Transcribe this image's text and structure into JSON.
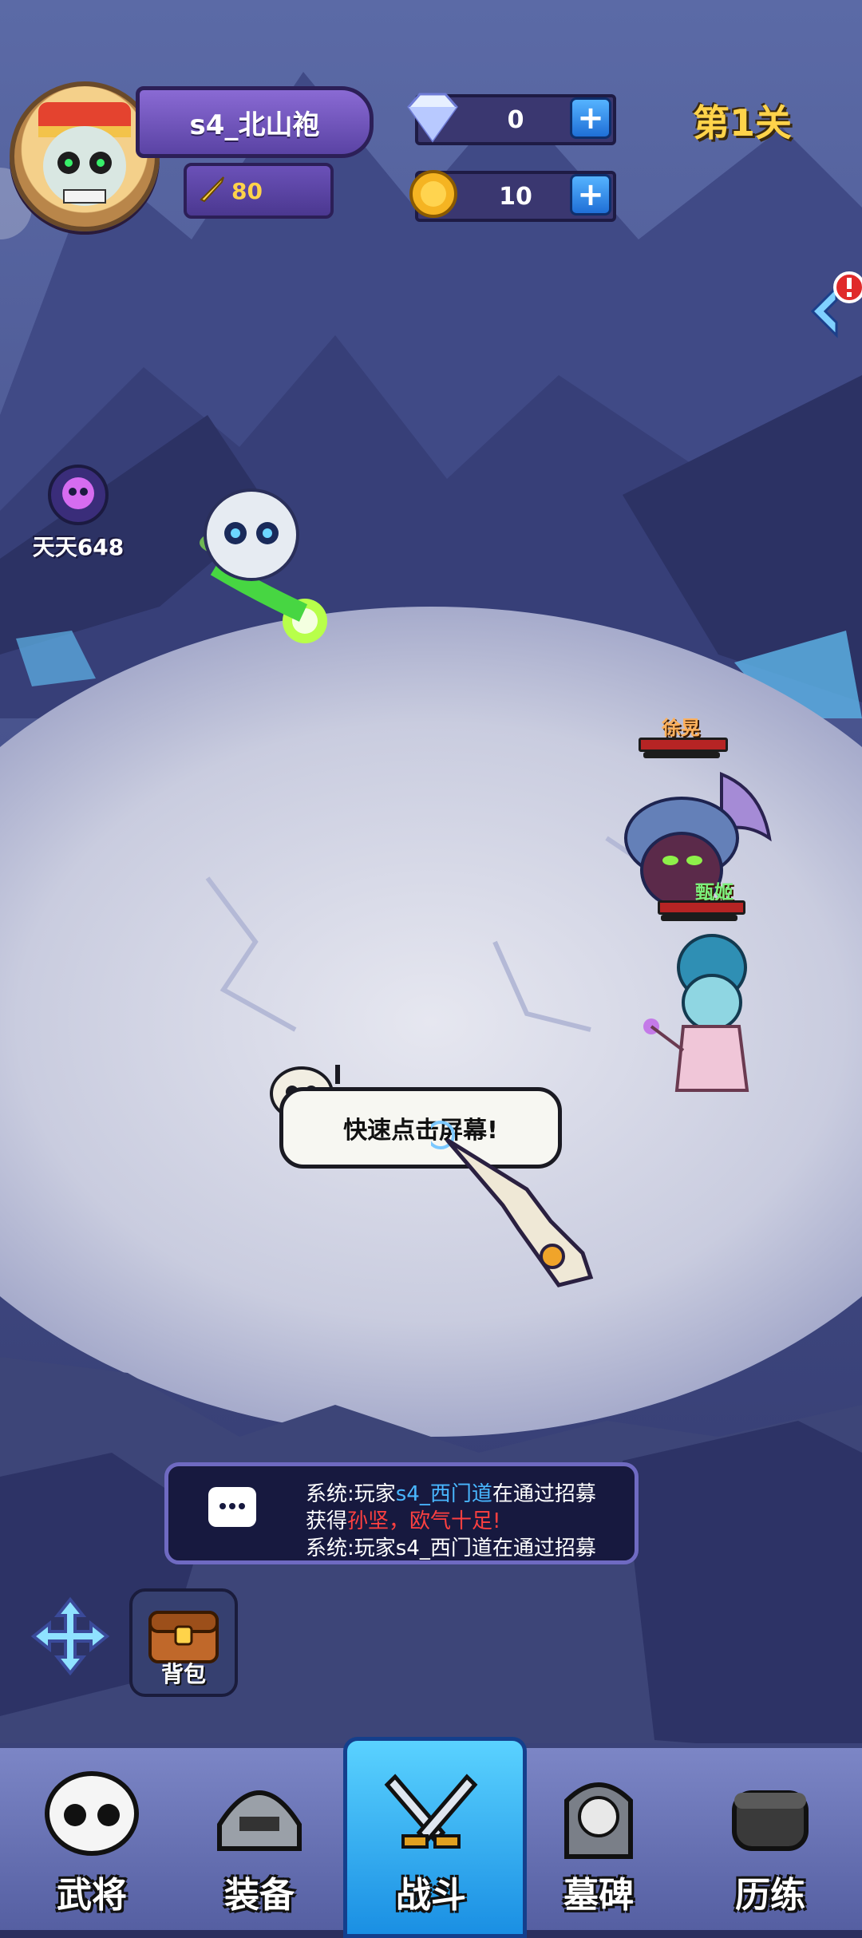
{
  "player": {
    "name": "s4_北山袍",
    "power": "80"
  },
  "resources": {
    "diamonds": "0",
    "coins": "10"
  },
  "stage": "第1关",
  "event_badge": {
    "label": "天天648"
  },
  "enemies": [
    {
      "name": "徐晃"
    },
    {
      "name": "甄姬"
    }
  ],
  "tap_hint": "快速点击屏幕!",
  "chat": {
    "line1_prefix": "系统:玩家",
    "line1_player": "s4_西门道",
    "line1_suffix": "在通过招募",
    "line2_prefix": "获得",
    "line2_hero": "孙坚",
    "line2_suffix": "，欧气十足!",
    "line3": "系统:玩家s4_西门道在通过招募"
  },
  "bag": {
    "label": "背包"
  },
  "nav": [
    {
      "label": "武将",
      "icon": "skull-icon"
    },
    {
      "label": "装备",
      "icon": "helmet-icon"
    },
    {
      "label": "战斗",
      "icon": "crossed-swords-icon"
    },
    {
      "label": "墓碑",
      "icon": "tombstone-icon"
    },
    {
      "label": "历练",
      "icon": "fist-icon"
    }
  ],
  "colors": {
    "accent": "#ffd34a",
    "nav_active": "#2fa9f0",
    "hp": "#b62424"
  }
}
